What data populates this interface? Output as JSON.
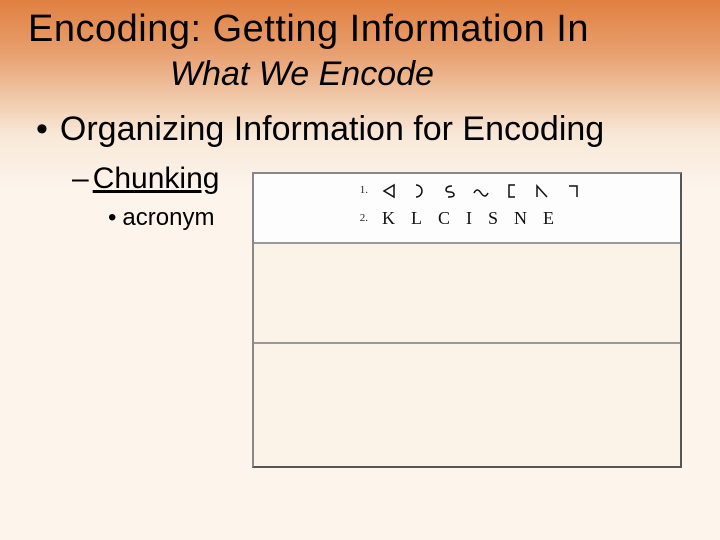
{
  "title": "Encoding: Getting Information In",
  "subtitle": "What We Encode",
  "main_bullet": "Organizing Information for Encoding",
  "sub_item": "Chunking",
  "sub_sub_item": "acronym",
  "figure": {
    "row1": {
      "index1": "1.",
      "index2": "2.",
      "letters": "KLCISNE",
      "glyph_names": [
        "triangle-left",
        "half-circle-right",
        "s-hook",
        "wave",
        "bracket-left",
        "angle-up-left",
        "corner-top-right"
      ]
    }
  }
}
